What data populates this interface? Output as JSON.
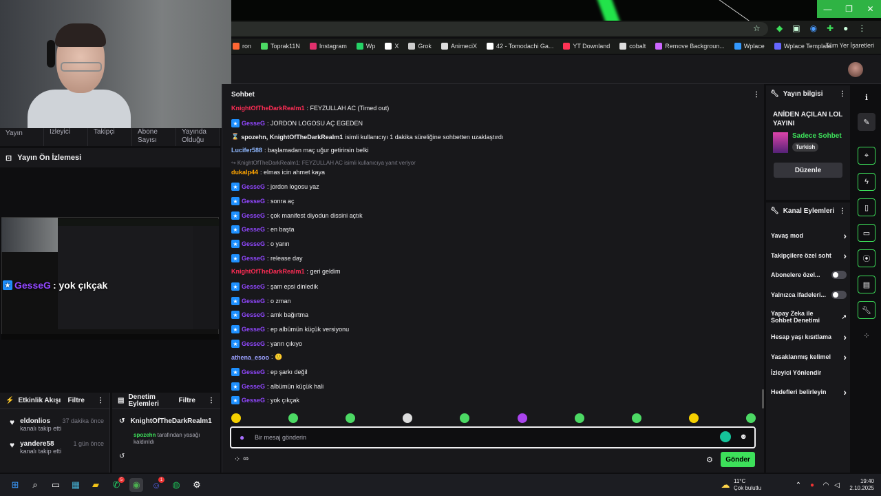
{
  "browser": {
    "window_controls": [
      "—",
      "❐",
      "✕"
    ],
    "bookmarks": [
      {
        "label": "ron",
        "color": "#ff6633"
      },
      {
        "label": "Toprak11N",
        "color": "#4cd964"
      },
      {
        "label": "Instagram",
        "color": "#e1306c"
      },
      {
        "label": "Wp",
        "color": "#25d366"
      },
      {
        "label": "X",
        "color": "#ffffff"
      },
      {
        "label": "Grok",
        "color": "#cccccc"
      },
      {
        "label": "AnimeciX",
        "color": "#dddddd"
      },
      {
        "label": "42 - Tomodachi Ga...",
        "color": "#ffffff"
      },
      {
        "label": "YT Downland",
        "color": "#ff3355"
      },
      {
        "label": "cobalt",
        "color": "#dddddd"
      },
      {
        "label": "Remove Backgroun...",
        "color": "#cc66ff"
      },
      {
        "label": "Wplace",
        "color": "#3399ff"
      },
      {
        "label": "Wplace Template",
        "color": "#6666ff"
      }
    ],
    "all_bookmarks": "Tüm Yer İşaretleri"
  },
  "left": {
    "stats": [
      "Yayın",
      "İzleyici",
      "Takipçi",
      "Abone Sayısı",
      "Yayında Olduğu"
    ],
    "preview_title": "Yayın Ön İzlemesi",
    "overlay_user": "GesseG",
    "overlay_text": ": yok çıkçak",
    "activity": {
      "title": "Etkinlik Akışı",
      "filter": "Filtre",
      "items": [
        {
          "user": "eldonlios",
          "time": "37 dakika önce",
          "sub": "kanalı takip etti"
        },
        {
          "user": "yandere58",
          "time": "1 gün önce",
          "sub": "kanalı takip etti"
        }
      ]
    },
    "moderation": {
      "title": "Denetim Eylemleri",
      "filter": "Filtre",
      "target": "KnightOfTheDarkRealm1",
      "actor": "spozehn",
      "action_text": " tarafından yasağı kaldırıldı"
    }
  },
  "chat": {
    "title": "Sohbet",
    "messages": [
      {
        "user": "KnightOfTheDarkRealm1",
        "cls": "knight",
        "badge": false,
        "text": ": FEYZULLAH AC (Timed out)"
      },
      {
        "user": "GesseG",
        "cls": "gesse",
        "badge": true,
        "text": ": JORDON LOGOSU AÇ EGEDEN"
      },
      {
        "user": "spozehn, KnightOfTheDarkRealm1",
        "cls": "sys",
        "badge": false,
        "text": " isimli kullanıcıyı 1 dakika süreliğine sohbetten uzaklaştırdı"
      },
      {
        "user": "Lucifer588",
        "cls": "lucifer",
        "badge": false,
        "text": ": başlamadan maç uğur getirirsin belki"
      },
      {
        "user": "",
        "cls": "sys",
        "badge": false,
        "text": "↪ KnightOfTheDarkRealm1: FEYZULLAH AC isimli kullanıcıya yanıt veriyor"
      },
      {
        "user": "dukalp44",
        "cls": "dukalp",
        "badge": false,
        "text": ": elmas icin ahmet kaya"
      },
      {
        "user": "GesseG",
        "cls": "gesse",
        "badge": true,
        "text": ": jordon logosu yaz"
      },
      {
        "user": "GesseG",
        "cls": "gesse",
        "badge": true,
        "text": ": sonra aç"
      },
      {
        "user": "GesseG",
        "cls": "gesse",
        "badge": true,
        "text": ": çok manifest diyodun dissini açtık"
      },
      {
        "user": "GesseG",
        "cls": "gesse",
        "badge": true,
        "text": ": en başta"
      },
      {
        "user": "GesseG",
        "cls": "gesse",
        "badge": true,
        "text": ": o yarın"
      },
      {
        "user": "GesseG",
        "cls": "gesse",
        "badge": true,
        "text": ": release day"
      },
      {
        "user": "KnightOfTheDarkRealm1",
        "cls": "knight",
        "badge": false,
        "text": ": geri geldim"
      },
      {
        "user": "GesseG",
        "cls": "gesse",
        "badge": true,
        "text": ": şam epsi dinledik"
      },
      {
        "user": "GesseG",
        "cls": "gesse",
        "badge": true,
        "text": ": o zman"
      },
      {
        "user": "GesseG",
        "cls": "gesse",
        "badge": true,
        "text": ": amk bağırtma"
      },
      {
        "user": "GesseG",
        "cls": "gesse",
        "badge": true,
        "text": ": ep albümün küçük versiyonu"
      },
      {
        "user": "GesseG",
        "cls": "gesse",
        "badge": true,
        "text": ": yarın çıkıyo"
      },
      {
        "user": "athena_esoo",
        "cls": "athena",
        "badge": false,
        "text": ": 🙂"
      },
      {
        "user": "GesseG",
        "cls": "gesse",
        "badge": true,
        "text": ": ep şarkı değil"
      },
      {
        "user": "GesseG",
        "cls": "gesse",
        "badge": true,
        "text": ": albümün küçük hali"
      },
      {
        "user": "GesseG",
        "cls": "gesse",
        "badge": true,
        "text": ": yok çıkçak"
      }
    ],
    "input_placeholder": "Bir mesaj gönderin",
    "send_label": "Gönder"
  },
  "stream_info": {
    "title": "Yayın bilgisi",
    "stream_title": "ANİDEN AÇILAN LOL YAYINI",
    "category": "Sadece Sohbet",
    "tag": "Turkish",
    "edit_label": "Düzenle"
  },
  "channel_actions": {
    "title": "Kanal Eylemleri",
    "items": [
      {
        "label": "Yavaş mod",
        "control": "chevron"
      },
      {
        "label": "Takipçilere özel soht",
        "control": "chevron"
      },
      {
        "label": "Abonelere özel...",
        "control": "toggle"
      },
      {
        "label": "Yalnızca ifadeleri...",
        "control": "toggle"
      },
      {
        "label": "Yapay Zeka ile Sohbet Denetimi",
        "control": "external"
      },
      {
        "label": "Hesap yaşı kısıtlama",
        "control": "chevron"
      },
      {
        "label": "Yasaklanmış kelimel",
        "control": "chevron"
      },
      {
        "label": "İzleyici Yönlendir",
        "control": "none"
      },
      {
        "label": "Hedefleri belirleyin",
        "control": "chevron"
      }
    ]
  },
  "taskbar": {
    "weather_temp": "11°C",
    "weather_desc": "Çok bulutlu",
    "time": "19:40",
    "date": "2.10.2025",
    "badges": {
      "whatsapp": "5",
      "discord": "1"
    }
  }
}
